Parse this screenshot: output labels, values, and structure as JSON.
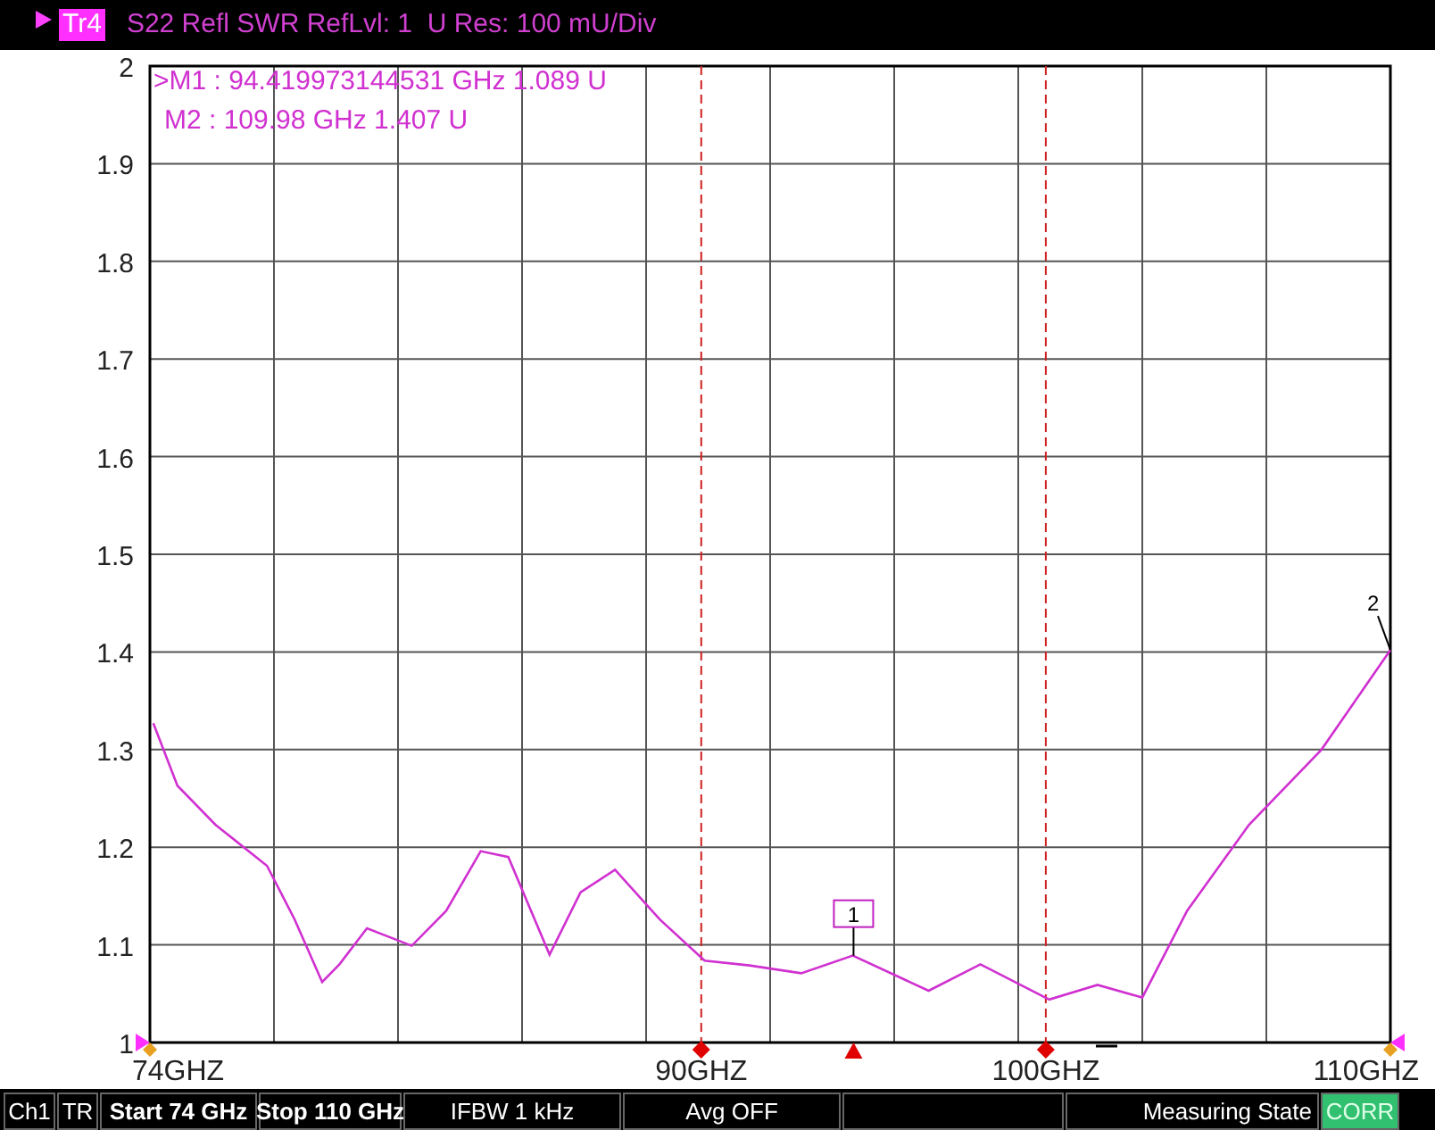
{
  "header": {
    "trace_label": "Tr4",
    "title": "S22 Refl SWR RefLvl: 1  U Res: 100 mU/Div"
  },
  "marker_table": [
    {
      "marker": ">M1",
      "separator": ":",
      "stimulus": "94.419973144531 GHz",
      "response": "1.089",
      "unit": "U"
    },
    {
      "marker": "M2",
      "separator": ":",
      "stimulus": "109.98 GHz",
      "response": "1.407",
      "unit": "U"
    }
  ],
  "stimulus_labels": {
    "start": "74GHZ",
    "stop": "110GHZ"
  },
  "chart_data": {
    "type": "line",
    "grid": true,
    "xlim": [
      74,
      110
    ],
    "ylim": [
      1,
      2
    ],
    "xticks": [
      {
        "value": 90,
        "label": "90GHZ"
      },
      {
        "value": 100,
        "label": "100GHZ"
      }
    ],
    "yticks": [
      1,
      {
        "value": 1.1,
        "label": "1.1"
      },
      {
        "value": 1.2,
        "label": "1.2"
      },
      {
        "value": 1.3,
        "label": "1.3"
      },
      {
        "value": 1.4,
        "label": "1.4"
      },
      {
        "value": 1.5,
        "label": "1.5"
      },
      {
        "value": 1.6,
        "label": "1.6"
      },
      {
        "value": 1.7,
        "label": "1.7"
      },
      {
        "value": 1.8,
        "label": "1.8"
      },
      {
        "value": 1.9,
        "label": "1.9"
      },
      2
    ],
    "x": [
      74.1,
      74.8,
      75.9,
      77.4,
      78.2,
      79.0,
      79.5,
      80.3,
      81.6,
      82.6,
      83.6,
      84.4,
      85.6,
      86.5,
      87.5,
      88.8,
      90.1,
      91.4,
      92.9,
      94.4,
      96.6,
      98.1,
      100.1,
      101.5,
      102.8,
      104.1,
      105.9,
      108.0,
      110.0
    ],
    "series": [
      {
        "color": "#d030d0",
        "values": [
          1.327,
          1.263,
          1.223,
          1.181,
          1.126,
          1.062,
          1.08,
          1.117,
          1.099,
          1.135,
          1.196,
          1.19,
          1.09,
          1.154,
          1.177,
          1.126,
          1.084,
          1.079,
          1.071,
          1.089,
          1.053,
          1.08,
          1.044,
          1.059,
          1.046,
          1.135,
          1.223,
          1.3,
          1.402
        ]
      }
    ],
    "ref_lines": [
      {
        "axis": "x",
        "value": 90
      },
      {
        "axis": "x",
        "value": 100
      }
    ],
    "annotations": [
      {
        "x": 94.42,
        "y": 1.089,
        "text": "1"
      },
      {
        "x": 110,
        "y": 1.402,
        "text": "2"
      }
    ]
  },
  "status_bar": [
    {
      "text": "Ch1",
      "bold": false,
      "highlight": false
    },
    {
      "text": "TR",
      "bold": false,
      "highlight": false
    },
    {
      "text": "Start 74 GHz",
      "bold": true,
      "highlight": false
    },
    {
      "text": "Stop 110 GHz",
      "bold": true,
      "highlight": false
    },
    {
      "text": "IFBW 1 kHz",
      "bold": false,
      "highlight": false
    },
    {
      "text": "Avg OFF",
      "bold": false,
      "highlight": false
    },
    {
      "text": "Measuring State",
      "bold": false,
      "highlight": false
    },
    {
      "text": "CORR",
      "bold": false,
      "highlight": true
    }
  ]
}
